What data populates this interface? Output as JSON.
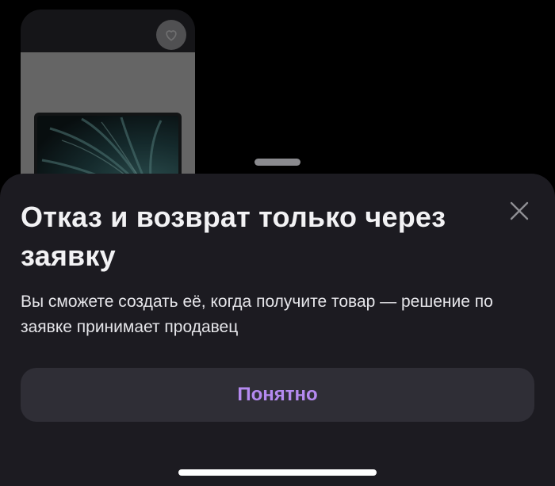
{
  "product_card": {
    "image_icon": "laptop-image",
    "favorite_icon": "heart-icon"
  },
  "sheet": {
    "title": "Отказ и возврат только через заявку",
    "description": "Вы сможете создать её, когда получите товар — решение по заявке принимает продавец",
    "close_icon": "close-icon",
    "button_label": "Понятно"
  },
  "colors": {
    "sheet_background": "#1c1b21",
    "button_background": "#2f2e36",
    "button_text": "#b58af0",
    "title_text": "#f2f2f4"
  }
}
